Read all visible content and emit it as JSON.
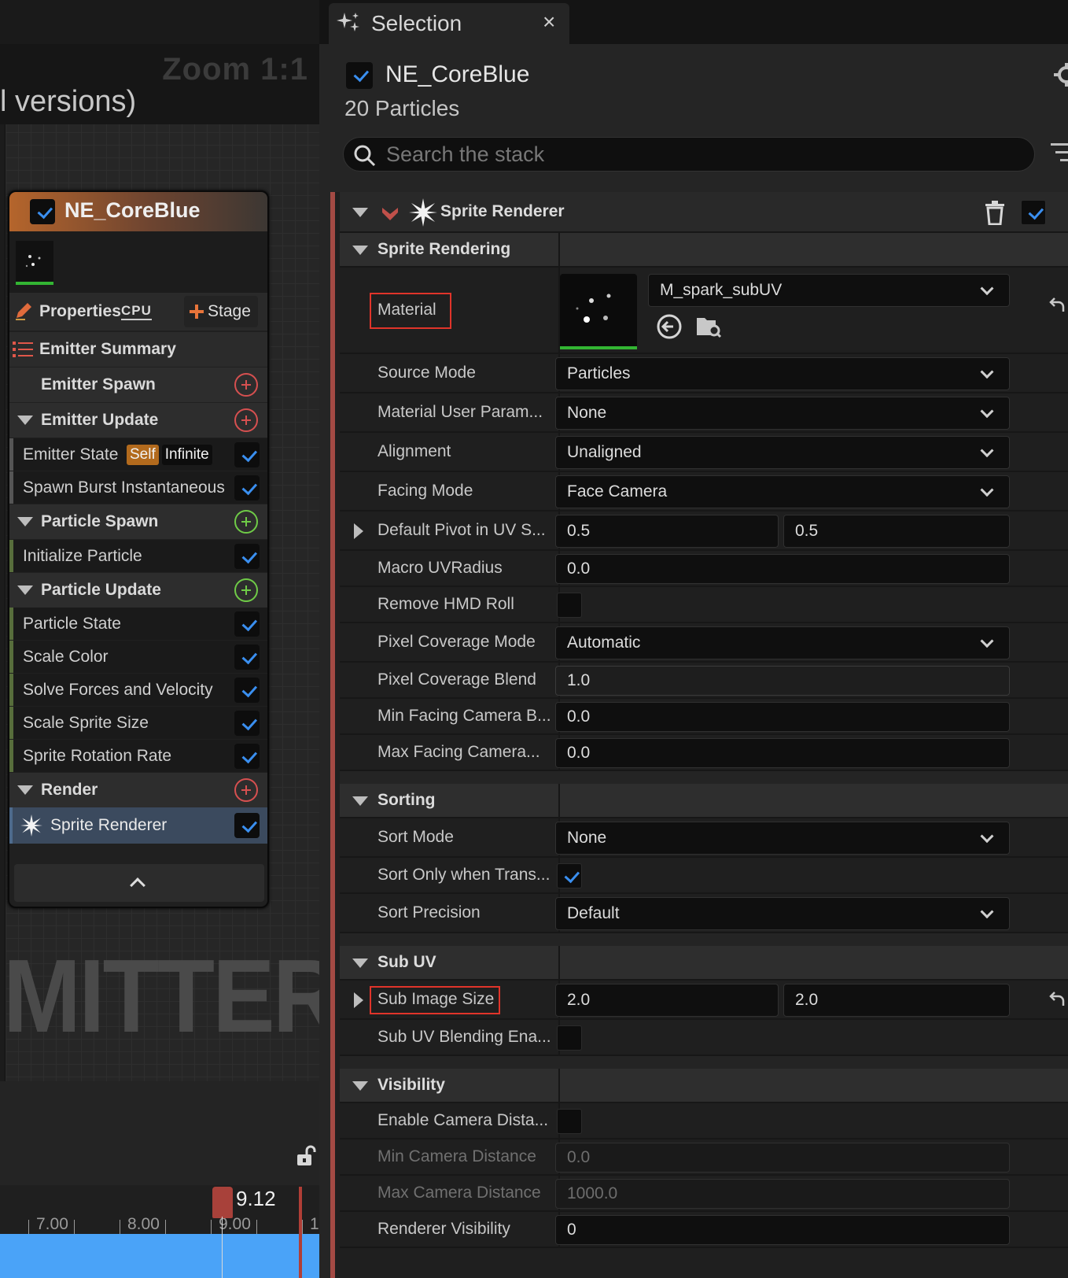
{
  "graph": {
    "zoom_label": "Zoom 1:1",
    "title_fragment": "l versions)",
    "watermark": "MITTER"
  },
  "node": {
    "name": "NE_CoreBlue",
    "enabled": true,
    "properties_label": "Properties",
    "sim_target": "CPU",
    "stage_label": "Stage",
    "emitter_summary_label": "Emitter Summary",
    "rows": [
      {
        "label": "Emitter Spawn",
        "kind": "group-plain",
        "plus": "red"
      },
      {
        "label": "Emitter Update",
        "kind": "group",
        "plus": "red"
      },
      {
        "label": "Emitter State",
        "kind": "item",
        "checked": true,
        "badges": [
          "Self",
          "Infinite"
        ]
      },
      {
        "label": "Spawn Burst Instantaneous",
        "kind": "item",
        "checked": true
      },
      {
        "label": "Particle Spawn",
        "kind": "group",
        "plus": "green"
      },
      {
        "label": "Initialize Particle",
        "kind": "item",
        "checked": true
      },
      {
        "label": "Particle Update",
        "kind": "group",
        "plus": "green"
      },
      {
        "label": "Particle State",
        "kind": "item",
        "checked": true
      },
      {
        "label": "Scale Color",
        "kind": "item",
        "checked": true
      },
      {
        "label": "Solve Forces and Velocity",
        "kind": "item",
        "checked": true
      },
      {
        "label": "Scale Sprite Size",
        "kind": "item",
        "checked": true
      },
      {
        "label": "Sprite Rotation Rate",
        "kind": "item",
        "checked": true
      },
      {
        "label": "Render",
        "kind": "group",
        "plus": "red"
      },
      {
        "label": "Sprite Renderer",
        "kind": "selected",
        "checked": true
      }
    ]
  },
  "timeline": {
    "current_time": "9.12",
    "ticks": [
      "7.00",
      "8.00",
      "9.00",
      "1"
    ]
  },
  "panel": {
    "tab_title": "Selection",
    "tab_close": "×",
    "emitter_name": "NE_CoreBlue",
    "particle_count": "20 Particles",
    "search_placeholder": "Search the stack",
    "module_title": "Sprite Renderer",
    "sections": {
      "sprite_rendering": "Sprite Rendering",
      "sorting": "Sorting",
      "sub_uv": "Sub UV",
      "visibility": "Visibility"
    },
    "props": {
      "material_label": "Material",
      "material_value": "M_spark_subUV",
      "source_mode_label": "Source Mode",
      "source_mode_value": "Particles",
      "mat_user_param_label": "Material User Param...",
      "mat_user_param_value": "None",
      "alignment_label": "Alignment",
      "alignment_value": "Unaligned",
      "facing_mode_label": "Facing Mode",
      "facing_mode_value": "Face Camera",
      "pivot_label": "Default Pivot in UV S...",
      "pivot_x": "0.5",
      "pivot_y": "0.5",
      "macro_uv_label": "Macro UVRadius",
      "macro_uv_value": "0.0",
      "remove_hmd_label": "Remove HMD Roll",
      "pixel_cov_mode_label": "Pixel Coverage Mode",
      "pixel_cov_mode_value": "Automatic",
      "pixel_cov_blend_label": "Pixel Coverage Blend",
      "pixel_cov_blend_value": "1.0",
      "min_facing_label": "Min Facing Camera B...",
      "min_facing_value": "0.0",
      "max_facing_label": "Max Facing Camera...",
      "max_facing_value": "0.0",
      "sort_mode_label": "Sort Mode",
      "sort_mode_value": "None",
      "sort_trans_label": "Sort Only when Trans...",
      "sort_precision_label": "Sort Precision",
      "sort_precision_value": "Default",
      "sub_image_label": "Sub Image Size",
      "sub_image_x": "2.0",
      "sub_image_y": "2.0",
      "sub_uv_blend_label": "Sub UV Blending Ena...",
      "enable_cam_dist_label": "Enable Camera Dista...",
      "min_cam_dist_label": "Min Camera Distance",
      "min_cam_dist_value": "0.0",
      "max_cam_dist_label": "Max Camera Distance",
      "max_cam_dist_value": "1000.0",
      "renderer_vis_label": "Renderer Visibility",
      "renderer_vis_value": "0"
    }
  },
  "colors": {
    "accent_blue": "#3a8ff0",
    "highlight_red": "#e0342a",
    "module_stripe": "#a34a44",
    "timeline_blue": "#4aa3f8"
  }
}
